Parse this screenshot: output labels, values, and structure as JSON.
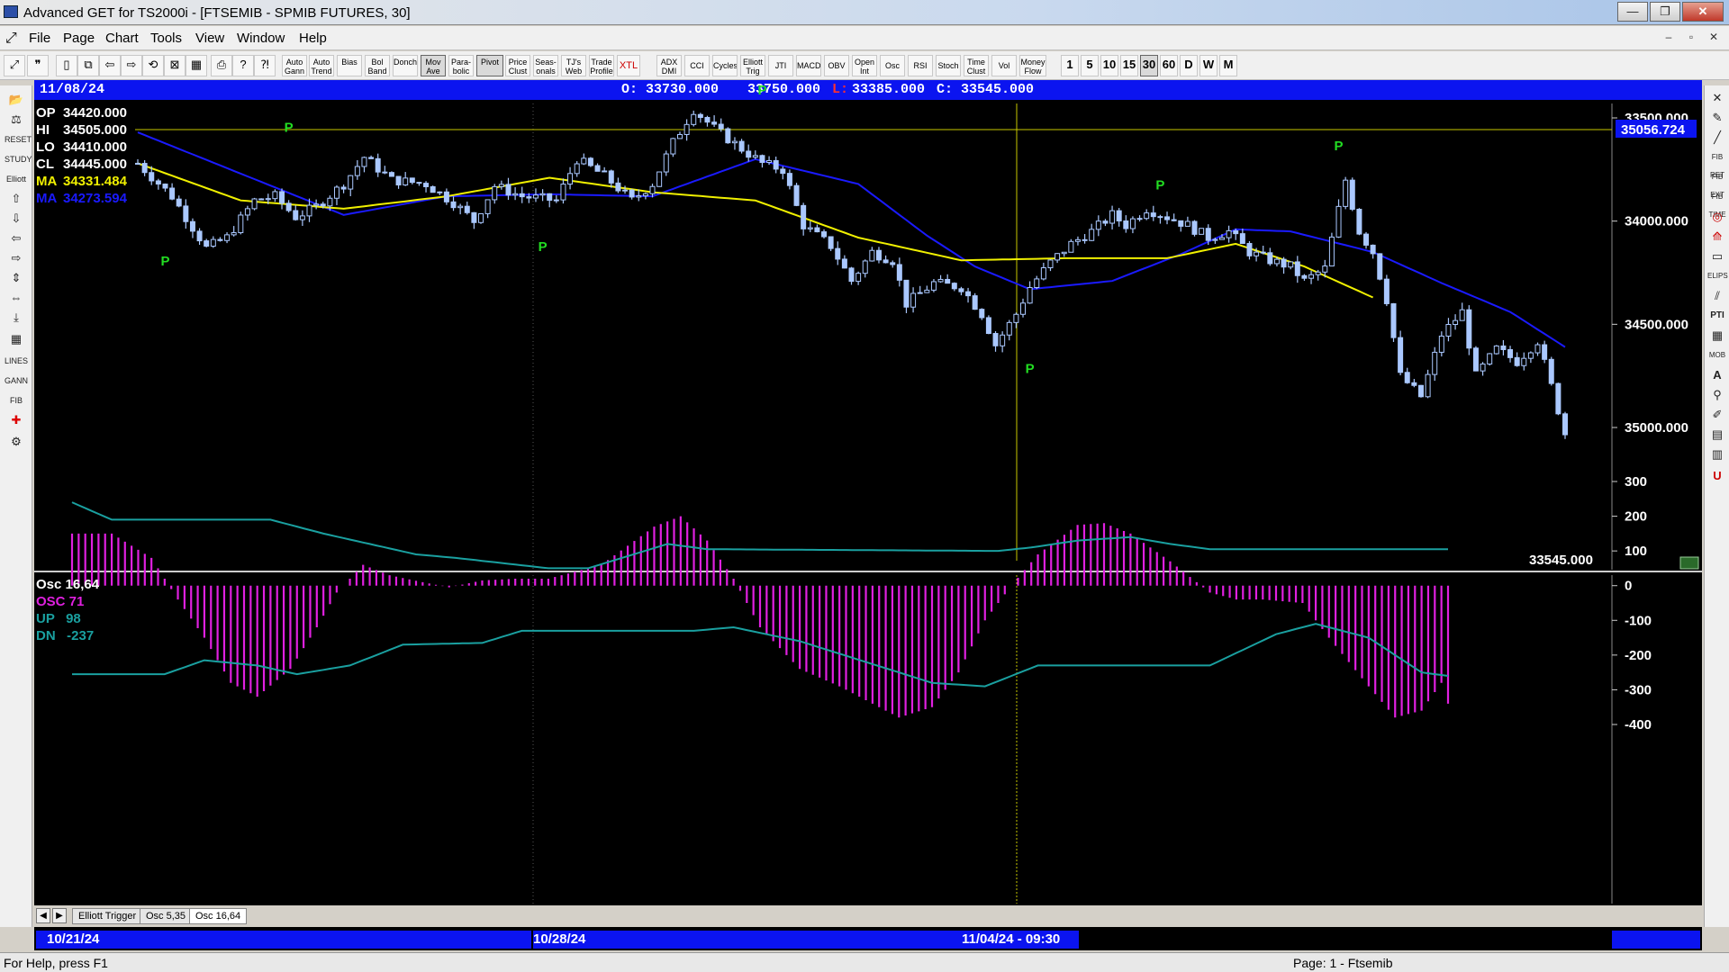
{
  "window": {
    "title": "Advanced GET for TS2000i - [FTSEMIB - SPMIB FUTURES, 30]"
  },
  "menu": [
    "File",
    "Page",
    "Chart",
    "Tools",
    "View",
    "Window",
    "Help"
  ],
  "toolbar": {
    "study_buttons": [
      "Auto Gann",
      "Auto Trend",
      "Bias",
      "Bol Band",
      "Donch",
      "Mov Ave",
      "Para-bolic",
      "Pivot",
      "Price Clust",
      "Seas-onals",
      "TJ's Web",
      "Trade Profile",
      "XTL",
      "ADX DMI",
      "CCI",
      "Cycles",
      "Elliott Trig",
      "JTI",
      "MACD",
      "OBV",
      "Open Int",
      "Osc",
      "RSI",
      "Stoch",
      "Time Clust",
      "Vol",
      "Money Flow"
    ],
    "intervals": [
      "1",
      "5",
      "10",
      "15",
      "30",
      "60",
      "D",
      "W",
      "M"
    ],
    "active_interval": "30"
  },
  "chart_header": {
    "date": "11/08/24",
    "open": "O: 33730.000",
    "high": "33750.000",
    "low_prefix": "L:",
    "low": "33385.000",
    "close": "C: 33545.000"
  },
  "price_panel": {
    "legend": [
      {
        "label": "OP",
        "value": "34420.000",
        "color": "#ffffff"
      },
      {
        "label": "HI",
        "value": "34505.000",
        "color": "#ffffff"
      },
      {
        "label": "LO",
        "value": "34410.000",
        "color": "#ffffff"
      },
      {
        "label": "CL",
        "value": "34445.000",
        "color": "#ffffff"
      },
      {
        "label": "MA",
        "value": "34331.484",
        "color": "#f0f000"
      },
      {
        "label": "MA",
        "value": "34273.594",
        "color": "#1a1aff"
      }
    ],
    "axis_labels": [
      "35000.000",
      "34500.000",
      "34000.000",
      "33500.000"
    ],
    "cursor_price": "35056.724",
    "last_price": "33545.000",
    "pivot_label": "P"
  },
  "osc_panel": {
    "legend": [
      {
        "label": "Osc 16,64",
        "color": "#ffffff"
      },
      {
        "label": "OSC 71",
        "color": "#e020e0"
      },
      {
        "label": "UP   98",
        "color": "#1aa0a0"
      },
      {
        "label": "DN   -237",
        "color": "#1aa0a0"
      }
    ],
    "axis_labels": [
      "300",
      "200",
      "100",
      "0",
      "-100",
      "-200",
      "-300",
      "-400"
    ]
  },
  "tabs": [
    "Elliott Trigger",
    "Osc 5,35",
    "Osc 16,64"
  ],
  "active_tab": "Osc 16,64",
  "date_axis": [
    "10/21/24",
    "10/28/24",
    "11/04/24 - 09:30"
  ],
  "status": {
    "help": "For Help, press F1",
    "page": "Page: 1 - Ftsemib"
  },
  "colors": {
    "background": "#000000",
    "header_bar": "#0b14f0",
    "candles": "#aac8ff",
    "ma_fast": "#f0f000",
    "ma_slow": "#1a1aff",
    "oscillator": "#e020e0",
    "bands": "#1aa0a0",
    "pivot": "#22dd22"
  },
  "chart_data": [
    {
      "type": "candlestick",
      "title": "FTSEMIB - SPMIB FUTURES, 30",
      "ylim": [
        33250,
        35150
      ],
      "y_ticks": [
        33500,
        34000,
        34500,
        35000
      ],
      "x_ticks": [
        "10/21/24",
        "10/28/24",
        "11/04/24 - 09:30"
      ],
      "close_path": [
        [
          0,
          34780
        ],
        [
          5,
          34620
        ],
        [
          8,
          34470
        ],
        [
          10,
          34370
        ],
        [
          13,
          34420
        ],
        [
          17,
          34600
        ],
        [
          20,
          34620
        ],
        [
          23,
          34520
        ],
        [
          26,
          34570
        ],
        [
          30,
          34680
        ],
        [
          33,
          34810
        ],
        [
          37,
          34700
        ],
        [
          42,
          34680
        ],
        [
          46,
          34590
        ],
        [
          49,
          34500
        ],
        [
          52,
          34670
        ],
        [
          56,
          34620
        ],
        [
          61,
          34600
        ],
        [
          64,
          34800
        ],
        [
          68,
          34720
        ],
        [
          72,
          34600
        ],
        [
          75,
          34680
        ],
        [
          78,
          34880
        ],
        [
          81,
          35040
        ],
        [
          84,
          34950
        ],
        [
          88,
          34850
        ],
        [
          91,
          34780
        ],
        [
          94,
          34750
        ],
        [
          97,
          34480
        ],
        [
          101,
          34380
        ],
        [
          104,
          34210
        ],
        [
          107,
          34350
        ],
        [
          110,
          34310
        ],
        [
          112,
          34100
        ],
        [
          116,
          34200
        ],
        [
          120,
          34180
        ],
        [
          123,
          34050
        ],
        [
          125,
          33900
        ],
        [
          128,
          34050
        ],
        [
          130,
          34180
        ],
        [
          133,
          34300
        ],
        [
          136,
          34390
        ],
        [
          139,
          34450
        ],
        [
          142,
          34530
        ],
        [
          144,
          34480
        ],
        [
          147,
          34560
        ],
        [
          150,
          34520
        ],
        [
          153,
          34480
        ],
        [
          156,
          34420
        ],
        [
          159,
          34450
        ],
        [
          162,
          34350
        ],
        [
          165,
          34310
        ],
        [
          168,
          34280
        ],
        [
          170,
          34210
        ],
        [
          173,
          34270
        ],
        [
          176,
          34700
        ],
        [
          178,
          34450
        ],
        [
          180,
          34350
        ],
        [
          182,
          34120
        ],
        [
          184,
          33750
        ],
        [
          187,
          33650
        ],
        [
          190,
          33950
        ],
        [
          193,
          34060
        ],
        [
          195,
          33750
        ],
        [
          198,
          33880
        ],
        [
          201,
          33820
        ],
        [
          204,
          33920
        ],
        [
          206,
          33700
        ],
        [
          208,
          33470
        ]
      ],
      "ma_yellow": [
        [
          0,
          34780
        ],
        [
          15,
          34600
        ],
        [
          30,
          34560
        ],
        [
          45,
          34620
        ],
        [
          60,
          34710
        ],
        [
          75,
          34640
        ],
        [
          90,
          34600
        ],
        [
          105,
          34420
        ],
        [
          120,
          34310
        ],
        [
          135,
          34320
        ],
        [
          150,
          34320
        ],
        [
          160,
          34390
        ],
        [
          170,
          34280
        ],
        [
          180,
          34130
        ]
      ],
      "ma_blue": [
        [
          0,
          34930
        ],
        [
          15,
          34730
        ],
        [
          30,
          34530
        ],
        [
          45,
          34620
        ],
        [
          60,
          34630
        ],
        [
          75,
          34620
        ],
        [
          90,
          34800
        ],
        [
          105,
          34680
        ],
        [
          115,
          34430
        ],
        [
          122,
          34280
        ],
        [
          130,
          34170
        ],
        [
          142,
          34210
        ],
        [
          152,
          34340
        ],
        [
          160,
          34460
        ],
        [
          168,
          34450
        ],
        [
          180,
          34350
        ],
        [
          190,
          34200
        ],
        [
          200,
          34060
        ],
        [
          208,
          33890
        ]
      ],
      "pivots": [
        {
          "bar": 22,
          "price": 34880,
          "kind": "high"
        },
        {
          "bar": 4,
          "price": 34380,
          "kind": "low"
        },
        {
          "bar": 59,
          "price": 34450,
          "kind": "low"
        },
        {
          "bar": 91,
          "price": 35060,
          "kind": "high"
        },
        {
          "bar": 130,
          "price": 33860,
          "kind": "low"
        },
        {
          "bar": 149,
          "price": 34600,
          "kind": "high"
        },
        {
          "bar": 175,
          "price": 34790,
          "kind": "high"
        }
      ]
    },
    {
      "type": "bar",
      "title": "Osc 16,64",
      "ylim": [
        -430,
        300
      ],
      "y_ticks": [
        300,
        200,
        100,
        0,
        -100,
        -200,
        -300,
        -400
      ],
      "osc_path": [
        [
          0,
          150
        ],
        [
          6,
          150
        ],
        [
          12,
          80
        ],
        [
          16,
          -40
        ],
        [
          20,
          -150
        ],
        [
          24,
          -280
        ],
        [
          28,
          -320
        ],
        [
          33,
          -240
        ],
        [
          37,
          -120
        ],
        [
          40,
          -20
        ],
        [
          44,
          60
        ],
        [
          48,
          30
        ],
        [
          53,
          10
        ],
        [
          57,
          -5
        ],
        [
          62,
          15
        ],
        [
          67,
          20
        ],
        [
          72,
          20
        ],
        [
          80,
          60
        ],
        [
          88,
          170
        ],
        [
          92,
          200
        ],
        [
          96,
          130
        ],
        [
          100,
          20
        ],
        [
          104,
          -120
        ],
        [
          110,
          -240
        ],
        [
          116,
          -290
        ],
        [
          120,
          -330
        ],
        [
          125,
          -380
        ],
        [
          130,
          -350
        ],
        [
          134,
          -250
        ],
        [
          138,
          -100
        ],
        [
          142,
          0
        ],
        [
          146,
          90
        ],
        [
          152,
          175
        ],
        [
          156,
          180
        ],
        [
          160,
          150
        ],
        [
          166,
          70
        ],
        [
          172,
          -20
        ],
        [
          176,
          -40
        ],
        [
          180,
          -40
        ],
        [
          186,
          -50
        ],
        [
          190,
          -150
        ],
        [
          196,
          -290
        ],
        [
          200,
          -380
        ],
        [
          204,
          -360
        ],
        [
          207,
          -280
        ],
        [
          208,
          -340
        ]
      ],
      "up_band": [
        [
          0,
          240
        ],
        [
          6,
          190
        ],
        [
          30,
          190
        ],
        [
          38,
          150
        ],
        [
          52,
          90
        ],
        [
          58,
          80
        ],
        [
          72,
          50
        ],
        [
          78,
          50
        ],
        [
          90,
          120
        ],
        [
          96,
          105
        ],
        [
          140,
          100
        ],
        [
          145,
          110
        ],
        [
          152,
          130
        ],
        [
          160,
          140
        ],
        [
          166,
          120
        ],
        [
          172,
          105
        ],
        [
          208,
          105
        ]
      ],
      "dn_band": [
        [
          0,
          -255
        ],
        [
          14,
          -255
        ],
        [
          20,
          -215
        ],
        [
          28,
          -230
        ],
        [
          34,
          -255
        ],
        [
          42,
          -230
        ],
        [
          50,
          -170
        ],
        [
          62,
          -165
        ],
        [
          68,
          -130
        ],
        [
          94,
          -130
        ],
        [
          100,
          -120
        ],
        [
          110,
          -160
        ],
        [
          120,
          -220
        ],
        [
          130,
          -280
        ],
        [
          138,
          -290
        ],
        [
          146,
          -230
        ],
        [
          172,
          -230
        ],
        [
          182,
          -140
        ],
        [
          188,
          -110
        ],
        [
          196,
          -150
        ],
        [
          204,
          -250
        ],
        [
          208,
          -260
        ]
      ]
    }
  ]
}
